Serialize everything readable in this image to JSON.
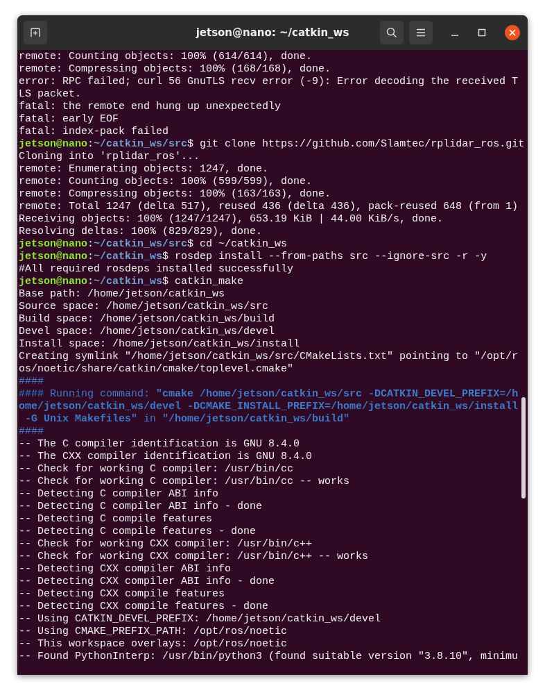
{
  "window": {
    "title": "jetson@nano: ~/catkin_ws"
  },
  "terminal": {
    "lines": [
      [
        {
          "kind": "plain",
          "text": "remote: Counting objects: 100% (614/614), done."
        }
      ],
      [
        {
          "kind": "plain",
          "text": "remote: Compressing objects: 100% (168/168), done."
        }
      ],
      [
        {
          "kind": "plain",
          "text": "error: RPC failed; curl 56 GnuTLS recv error (-9): Error decoding the received T"
        }
      ],
      [
        {
          "kind": "plain",
          "text": "LS packet."
        }
      ],
      [
        {
          "kind": "plain",
          "text": "fatal: the remote end hung up unexpectedly"
        }
      ],
      [
        {
          "kind": "plain",
          "text": "fatal: early EOF"
        }
      ],
      [
        {
          "kind": "plain",
          "text": "fatal: index-pack failed"
        }
      ],
      [
        {
          "kind": "user",
          "text": "jetson@nano"
        },
        {
          "kind": "plain",
          "text": ":"
        },
        {
          "kind": "path",
          "text": "~/catkin_ws/src"
        },
        {
          "kind": "plain",
          "text": "$ git clone https://github.com/Slamtec/rplidar_ros.git"
        }
      ],
      [
        {
          "kind": "plain",
          "text": "Cloning into 'rplidar_ros'..."
        }
      ],
      [
        {
          "kind": "plain",
          "text": "remote: Enumerating objects: 1247, done."
        }
      ],
      [
        {
          "kind": "plain",
          "text": "remote: Counting objects: 100% (599/599), done."
        }
      ],
      [
        {
          "kind": "plain",
          "text": "remote: Compressing objects: 100% (163/163), done."
        }
      ],
      [
        {
          "kind": "plain",
          "text": "remote: Total 1247 (delta 517), reused 436 (delta 436), pack-reused 648 (from 1)"
        }
      ],
      [
        {
          "kind": "plain",
          "text": "Receiving objects: 100% (1247/1247), 653.19 KiB | 44.00 KiB/s, done."
        }
      ],
      [
        {
          "kind": "plain",
          "text": "Resolving deltas: 100% (829/829), done."
        }
      ],
      [
        {
          "kind": "user",
          "text": "jetson@nano"
        },
        {
          "kind": "plain",
          "text": ":"
        },
        {
          "kind": "path",
          "text": "~/catkin_ws/src"
        },
        {
          "kind": "plain",
          "text": "$ cd ~/catkin_ws"
        }
      ],
      [
        {
          "kind": "user",
          "text": "jetson@nano"
        },
        {
          "kind": "plain",
          "text": ":"
        },
        {
          "kind": "path",
          "text": "~/catkin_ws"
        },
        {
          "kind": "plain",
          "text": "$ rosdep install --from-paths src --ignore-src -r -y"
        }
      ],
      [
        {
          "kind": "plain",
          "text": "#All required rosdeps installed successfully"
        }
      ],
      [
        {
          "kind": "user",
          "text": "jetson@nano"
        },
        {
          "kind": "plain",
          "text": ":"
        },
        {
          "kind": "path",
          "text": "~/catkin_ws"
        },
        {
          "kind": "plain",
          "text": "$ catkin_make"
        }
      ],
      [
        {
          "kind": "plain",
          "text": "Base path: /home/jetson/catkin_ws"
        }
      ],
      [
        {
          "kind": "plain",
          "text": "Source space: /home/jetson/catkin_ws/src"
        }
      ],
      [
        {
          "kind": "plain",
          "text": "Build space: /home/jetson/catkin_ws/build"
        }
      ],
      [
        {
          "kind": "plain",
          "text": "Devel space: /home/jetson/catkin_ws/devel"
        }
      ],
      [
        {
          "kind": "plain",
          "text": "Install space: /home/jetson/catkin_ws/install"
        }
      ],
      [
        {
          "kind": "plain",
          "text": "Creating symlink \"/home/jetson/catkin_ws/src/CMakeLists.txt\" pointing to \"/opt/r"
        }
      ],
      [
        {
          "kind": "plain",
          "text": "os/noetic/share/catkin/cmake/toplevel.cmake\""
        }
      ],
      [
        {
          "kind": "note",
          "text": "####"
        }
      ],
      [
        {
          "kind": "note",
          "text": "#### Running command: "
        },
        {
          "kind": "strong",
          "text": "\"cmake /home/jetson/catkin_ws/src -DCATKIN_DEVEL_PREFIX=/h"
        }
      ],
      [
        {
          "kind": "strong",
          "text": "ome/jetson/catkin_ws/devel -DCMAKE_INSTALL_PREFIX=/home/jetson/catkin_ws/install"
        }
      ],
      [
        {
          "kind": "strong",
          "text": " -G Unix Makefiles\""
        },
        {
          "kind": "note",
          "text": " in "
        },
        {
          "kind": "strong",
          "text": "\"/home/jetson/catkin_ws/build\""
        }
      ],
      [
        {
          "kind": "note",
          "text": "####"
        }
      ],
      [
        {
          "kind": "plain",
          "text": "-- The C compiler identification is GNU 8.4.0"
        }
      ],
      [
        {
          "kind": "plain",
          "text": "-- The CXX compiler identification is GNU 8.4.0"
        }
      ],
      [
        {
          "kind": "plain",
          "text": "-- Check for working C compiler: /usr/bin/cc"
        }
      ],
      [
        {
          "kind": "plain",
          "text": "-- Check for working C compiler: /usr/bin/cc -- works"
        }
      ],
      [
        {
          "kind": "plain",
          "text": "-- Detecting C compiler ABI info"
        }
      ],
      [
        {
          "kind": "plain",
          "text": "-- Detecting C compiler ABI info - done"
        }
      ],
      [
        {
          "kind": "plain",
          "text": "-- Detecting C compile features"
        }
      ],
      [
        {
          "kind": "plain",
          "text": "-- Detecting C compile features - done"
        }
      ],
      [
        {
          "kind": "plain",
          "text": "-- Check for working CXX compiler: /usr/bin/c++"
        }
      ],
      [
        {
          "kind": "plain",
          "text": "-- Check for working CXX compiler: /usr/bin/c++ -- works"
        }
      ],
      [
        {
          "kind": "plain",
          "text": "-- Detecting CXX compiler ABI info"
        }
      ],
      [
        {
          "kind": "plain",
          "text": "-- Detecting CXX compiler ABI info - done"
        }
      ],
      [
        {
          "kind": "plain",
          "text": "-- Detecting CXX compile features"
        }
      ],
      [
        {
          "kind": "plain",
          "text": "-- Detecting CXX compile features - done"
        }
      ],
      [
        {
          "kind": "plain",
          "text": "-- Using CATKIN_DEVEL_PREFIX: /home/jetson/catkin_ws/devel"
        }
      ],
      [
        {
          "kind": "plain",
          "text": "-- Using CMAKE_PREFIX_PATH: /opt/ros/noetic"
        }
      ],
      [
        {
          "kind": "plain",
          "text": "-- This workspace overlays: /opt/ros/noetic"
        }
      ],
      [
        {
          "kind": "plain",
          "text": "-- Found PythonInterp: /usr/bin/python3 (found suitable version \"3.8.10\", minimu"
        }
      ]
    ]
  }
}
